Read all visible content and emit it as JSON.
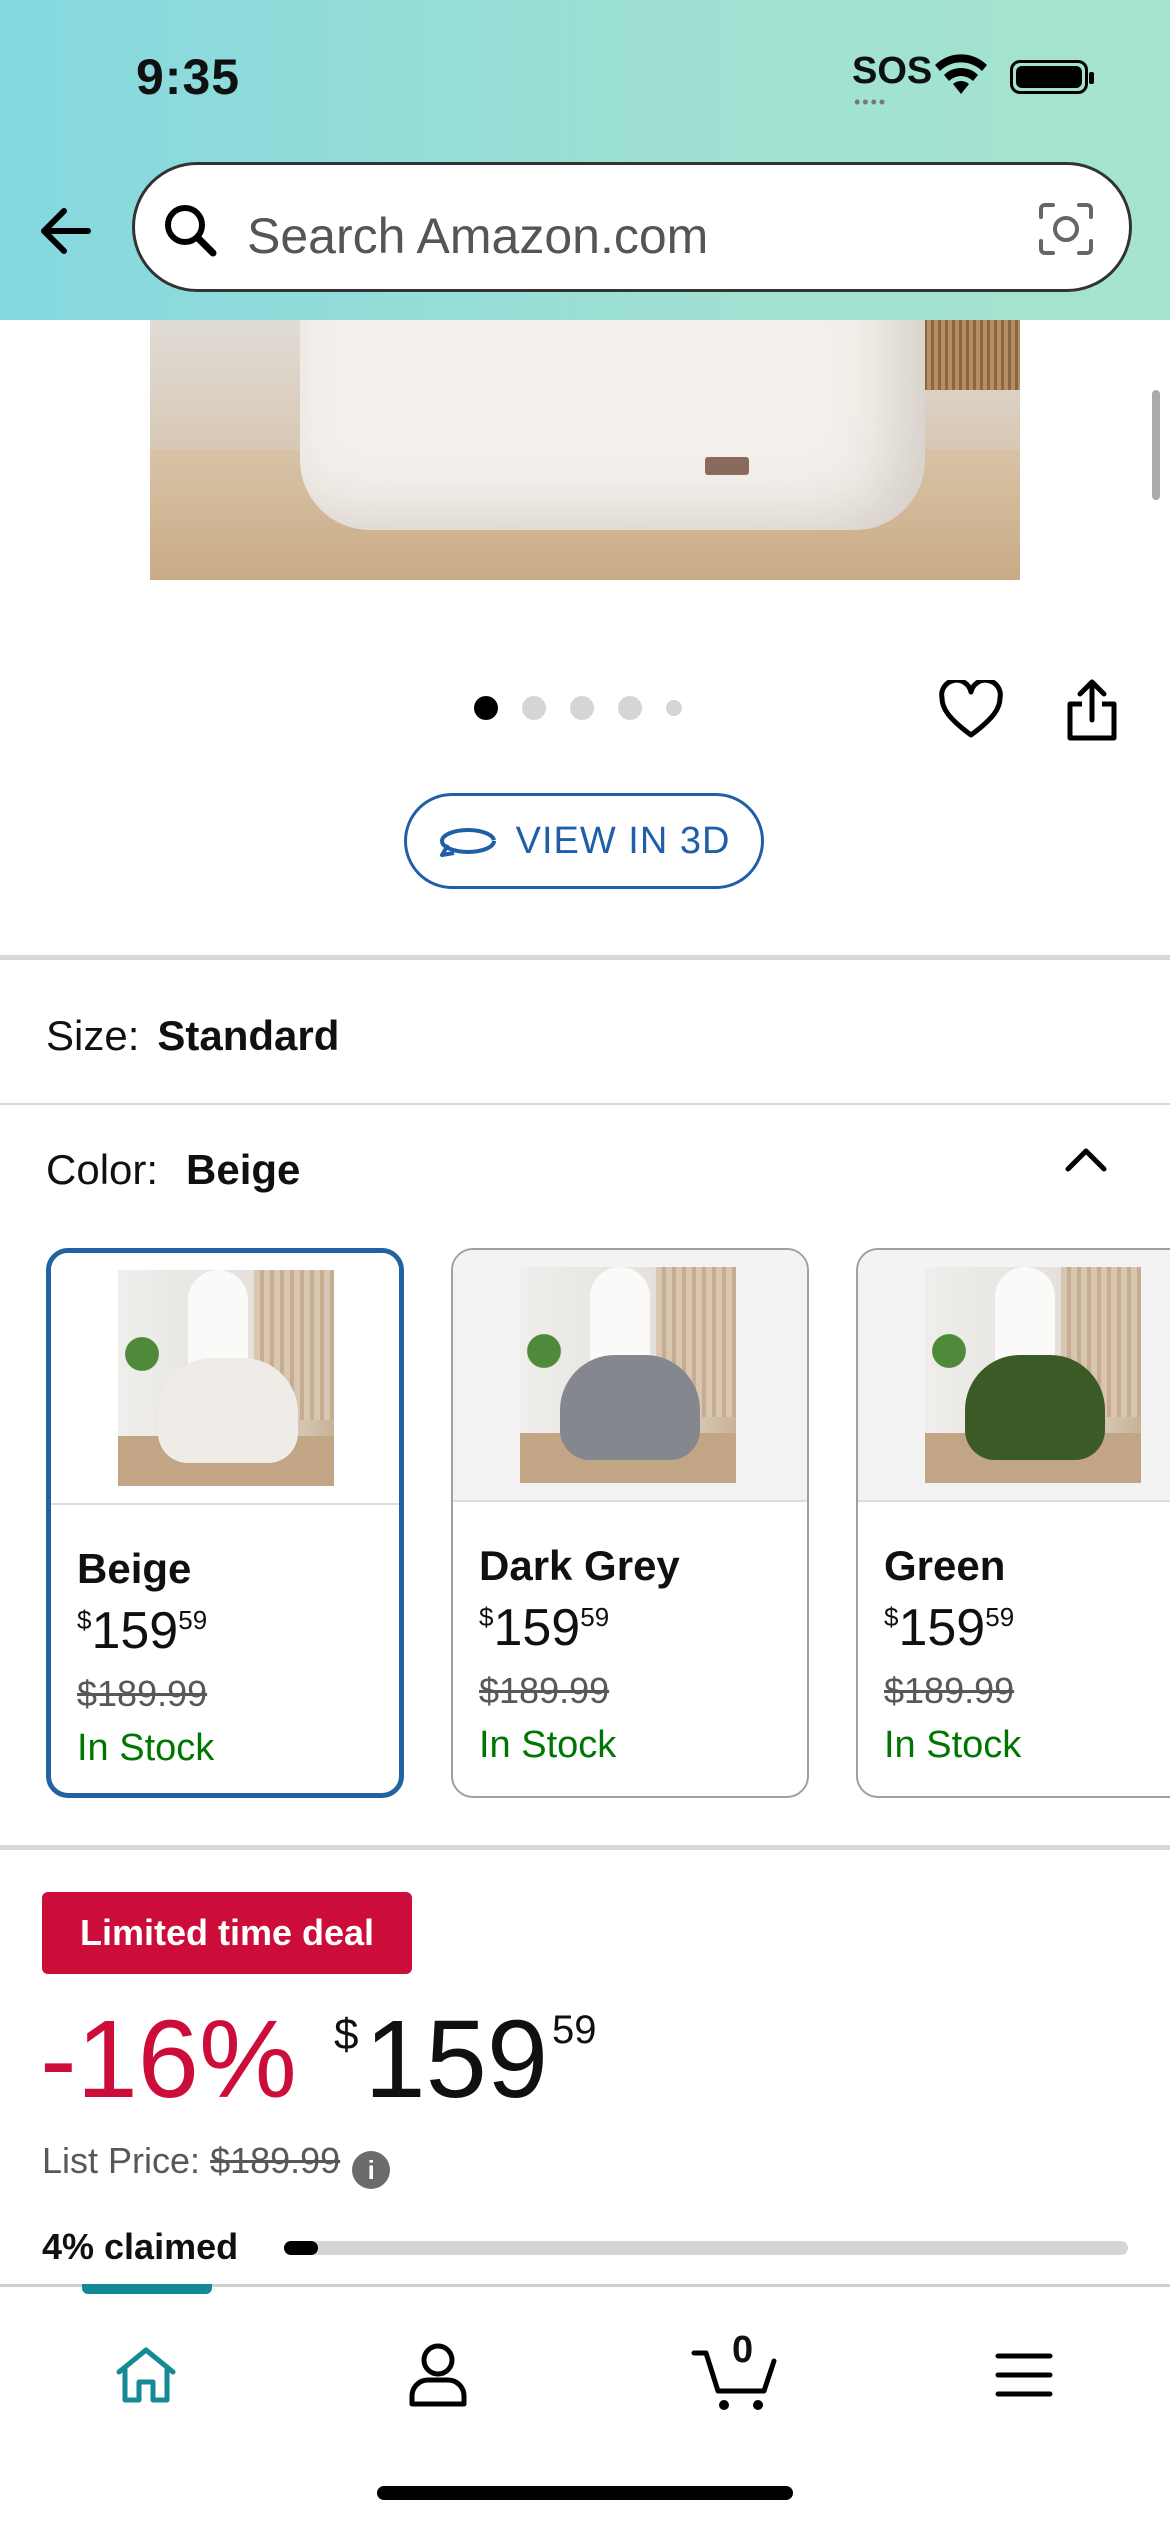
{
  "status_bar": {
    "time": "9:35",
    "sos": "SOS"
  },
  "search": {
    "placeholder": "Search Amazon.com"
  },
  "gallery": {
    "dot_count": 5,
    "active_index": 0
  },
  "view3d": {
    "label": "VIEW IN 3D"
  },
  "size": {
    "label": "Size:",
    "value": "Standard"
  },
  "color": {
    "label": "Color:",
    "value": "Beige",
    "options": [
      {
        "name": "Beige",
        "dollars": "159",
        "cents": "59",
        "currency": "$",
        "old_price": "$189.99",
        "stock": "In Stock",
        "selected": true,
        "chair_color": "#efece7"
      },
      {
        "name": "Dark Grey",
        "dollars": "159",
        "cents": "59",
        "currency": "$",
        "old_price": "$189.99",
        "stock": "In Stock",
        "selected": false,
        "chair_color": "#85878e"
      },
      {
        "name": "Green",
        "dollars": "159",
        "cents": "59",
        "currency": "$",
        "old_price": "$189.99",
        "stock": "In Stock",
        "selected": false,
        "chair_color": "#3c5a26"
      }
    ]
  },
  "deal": {
    "badge": "Limited time deal",
    "discount": "-16%",
    "currency": "$",
    "dollars": "159",
    "cents": "59",
    "list_price_label": "List Price:",
    "list_price": "$189.99",
    "info": "i",
    "claimed_label": "4% claimed",
    "claimed_fraction": 0.04
  },
  "bottom_nav": {
    "items": [
      "home-icon",
      "account-icon",
      "cart-icon",
      "menu-icon"
    ],
    "cart_count": "0",
    "active": "home"
  },
  "colors": {
    "accent_blue": "#2162a1",
    "deal_red": "#cc0c39",
    "stock_green": "#007600",
    "nav_teal": "#138a96"
  }
}
